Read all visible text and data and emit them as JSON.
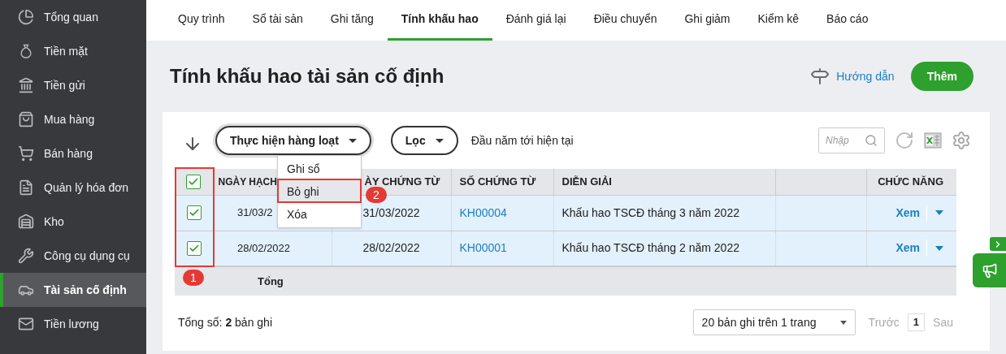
{
  "sidebar": {
    "items": [
      {
        "kind": "pie",
        "label": "Tổng quan",
        "selected": false
      },
      {
        "kind": "bag",
        "label": "Tiền mặt",
        "selected": false
      },
      {
        "kind": "bank",
        "label": "Tiền gửi",
        "selected": false
      },
      {
        "kind": "shop",
        "label": "Mua hàng",
        "selected": false
      },
      {
        "kind": "cart",
        "label": "Bán hàng",
        "selected": false
      },
      {
        "kind": "doc",
        "label": "Quản lý hóa đơn",
        "selected": false
      },
      {
        "kind": "store",
        "label": "Kho",
        "selected": false
      },
      {
        "kind": "tools",
        "label": "Công cụ dụng cụ",
        "selected": false
      },
      {
        "kind": "car",
        "label": "Tài sản cố định",
        "selected": true
      },
      {
        "kind": "salary",
        "label": "Tiền lương",
        "selected": false
      }
    ]
  },
  "tabs": [
    {
      "label": "Quy trình",
      "selected": false
    },
    {
      "label": "Sổ tài sản",
      "selected": false
    },
    {
      "label": "Ghi tăng",
      "selected": false
    },
    {
      "label": "Tính khấu hao",
      "selected": true
    },
    {
      "label": "Đánh giá lại",
      "selected": false
    },
    {
      "label": "Điều chuyển",
      "selected": false
    },
    {
      "label": "Ghi giảm",
      "selected": false
    },
    {
      "label": "Kiểm kê",
      "selected": false
    },
    {
      "label": "Báo cáo",
      "selected": false
    }
  ],
  "page_title": "Tính khấu hao tài sản cố định",
  "guide_link": "Hướng dẫn",
  "add_button": "Thêm",
  "toolbar": {
    "bulk_button": "Thực hiện hàng loạt",
    "filter_button": "Lọc",
    "period": "Đầu năm tới hiện tại",
    "search": {
      "placeholder": "Nhập"
    }
  },
  "bulk_menu": [
    {
      "label": "Ghi sổ",
      "selected": false
    },
    {
      "label": "Bỏ ghi",
      "selected": true
    },
    {
      "label": "Xóa",
      "selected": false
    }
  ],
  "table": {
    "header_checked": true,
    "columns": [
      "NGÀY HẠCH",
      "ÀY CHỨNG TỪ",
      "SỐ CHỨNG TỪ",
      "DIỄN GIẢI",
      "CHỨC NĂNG"
    ],
    "rows": [
      {
        "checked": true,
        "posting_date": "31/03/2",
        "voucher_date": "31/03/2022",
        "voucher_no": "KH00004",
        "description": "Khấu hao TSCĐ tháng 3 năm 2022",
        "action": "Xem"
      },
      {
        "checked": true,
        "posting_date": "28/02/2022",
        "voucher_date": "28/02/2022",
        "voucher_no": "KH00001",
        "description": "Khấu hao TSCĐ tháng 2 năm 2022",
        "action": "Xem"
      }
    ],
    "total_label": "Tổng"
  },
  "footer": {
    "total": "Tổng số: **2** bản ghi",
    "page_size": "20 bản ghi trên 1 trang",
    "prev": "Trước",
    "page": "1",
    "next": "Sau",
    "prev_disabled": true
  },
  "annotations": [
    {
      "label": "1"
    },
    {
      "label": "2"
    }
  ]
}
